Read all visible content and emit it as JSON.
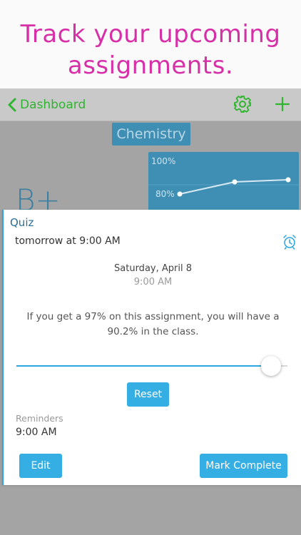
{
  "promo": {
    "headline_line1": "Track your upcoming",
    "headline_line2": "assignments."
  },
  "navbar": {
    "back_label": "Dashboard",
    "settings_icon": "gear-icon",
    "add_icon": "plus-icon"
  },
  "background": {
    "course_name": "Chemistry",
    "grade_letter": "B+",
    "chart": {
      "y_label_top": "100%",
      "y_label_mid": "80%"
    }
  },
  "assignment": {
    "type": "Quiz",
    "due": "tomorrow at 9:00 AM",
    "date": "Saturday, April 8",
    "time": "9:00 AM",
    "projection_text": "If you get a 97% on this assignment, you will have a 90.2% in the class.",
    "slider_value_fraction": 0.94,
    "reset_label": "Reset",
    "reminders_label": "Reminders",
    "reminder_time": "9:00 AM",
    "edit_label": "Edit",
    "mark_complete_label": "Mark Complete"
  },
  "colors": {
    "promo_text": "#d62fa7",
    "nav_accent": "#2fb52f",
    "button_blue": "#34aee3",
    "course_blue": "#3f8fb4"
  }
}
